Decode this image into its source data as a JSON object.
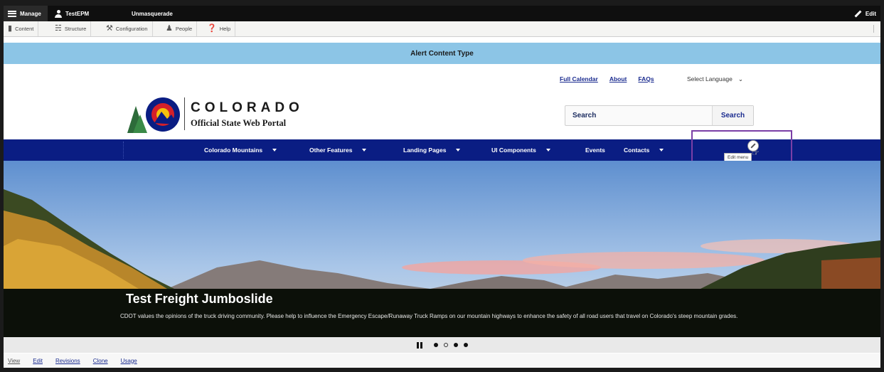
{
  "admin_toolbar": {
    "manage_label": "Manage",
    "user_label": "TestEPM",
    "unmasquerade_label": "Unmasquerade",
    "edit_label": "Edit"
  },
  "admin_tray": {
    "items": [
      {
        "label": "Content",
        "icon": "content-icon"
      },
      {
        "label": "Structure",
        "icon": "structure-icon"
      },
      {
        "label": "Configuration",
        "icon": "wrench-icon"
      },
      {
        "label": "People",
        "icon": "people-icon"
      },
      {
        "label": "Help",
        "icon": "help-icon"
      }
    ]
  },
  "alert": {
    "text": "Alert Content Type"
  },
  "utility_nav": {
    "links": [
      "Full Calendar",
      "About",
      "FAQs"
    ],
    "language_select": "Select Language"
  },
  "branding": {
    "wordmark": "COLORADO",
    "tagline": "Official State Web Portal"
  },
  "search": {
    "placeholder": "Search",
    "button_label": "Search"
  },
  "main_nav": {
    "items": [
      {
        "label": "Colorado Mountains",
        "has_dropdown": true
      },
      {
        "label": "Other Features",
        "has_dropdown": true
      },
      {
        "label": "Landing Pages",
        "has_dropdown": true
      },
      {
        "label": "UI Components",
        "has_dropdown": true
      },
      {
        "label": "Events",
        "has_dropdown": false
      },
      {
        "label": "Contacts",
        "has_dropdown": true
      }
    ],
    "edit_tooltip": "Edit menu"
  },
  "slide": {
    "title": "Test Freight Jumboslide",
    "body": "CDOT values the opinions of the truck driving community. Please help to influence the Emergency Escape/Runaway Truck Ramps on our mountain highways to enhance the safety of all road users that travel on Colorado's steep mountain grades."
  },
  "carousel": {
    "slide_count": 4,
    "active_index": 1
  },
  "local_tabs": [
    "View",
    "Edit",
    "Revisions",
    "Clone",
    "Usage"
  ],
  "colors": {
    "nav_blue": "#0a1d83",
    "alert_blue": "#8cc5e6",
    "highlight_purple": "#7b3fa6"
  }
}
